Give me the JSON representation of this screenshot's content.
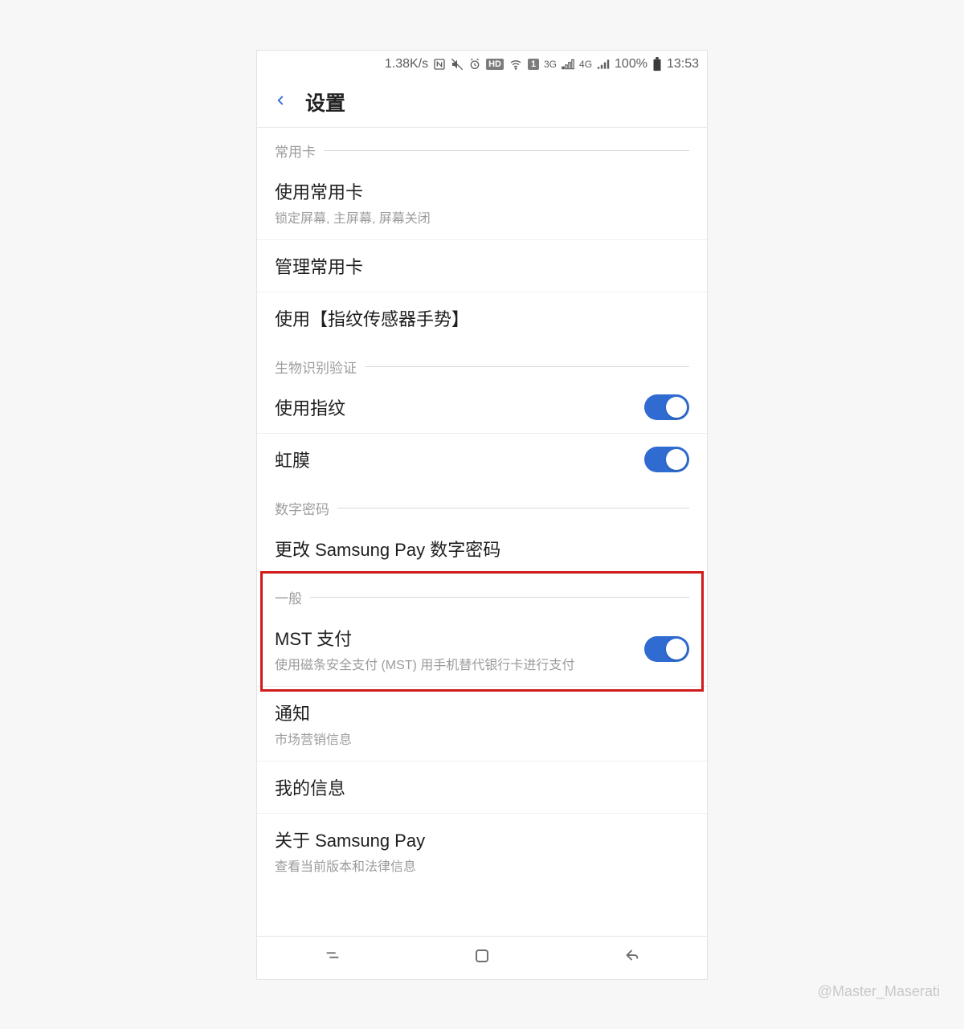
{
  "statusbar": {
    "speed": "1.38K/s",
    "battery_text": "100%",
    "time": "13:53",
    "net_3g": "3G",
    "net_4g": "4G",
    "sim_index": "1",
    "hd_label": "HD"
  },
  "header": {
    "title": "设置"
  },
  "sections": {
    "common_card": {
      "header": "常用卡",
      "use_common_label": "使用常用卡",
      "use_common_sub": "锁定屏幕, 主屏幕, 屏幕关闭",
      "manage_label": "管理常用卡",
      "fingerprint_gesture_label": "使用【指纹传感器手势】"
    },
    "biometric": {
      "header": "生物识别验证",
      "fingerprint_label": "使用指纹",
      "fingerprint_on": true,
      "iris_label": "虹膜",
      "iris_on": true
    },
    "pin": {
      "header": "数字密码",
      "change_pin_label": "更改 Samsung Pay 数字密码"
    },
    "general": {
      "header": "一般",
      "mst_label": "MST 支付",
      "mst_sub": "使用磁条安全支付 (MST) 用手机替代银行卡进行支付",
      "mst_on": true,
      "notify_label": "通知",
      "notify_sub": "市场营销信息",
      "myinfo_label": "我的信息",
      "about_label": "关于 Samsung Pay",
      "about_sub": "查看当前版本和法律信息"
    }
  },
  "watermark": "@Master_Maserati"
}
